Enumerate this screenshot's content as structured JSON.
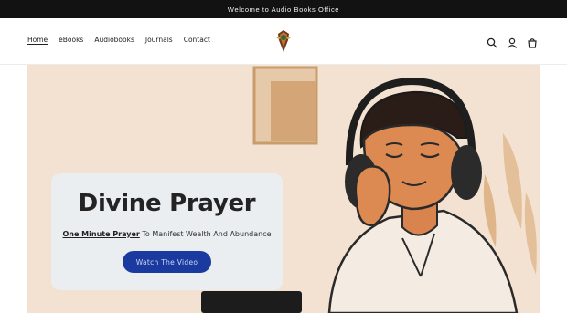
{
  "announcement": {
    "text": "Welcome to Audio Books Office"
  },
  "nav": {
    "items": [
      {
        "label": "Home",
        "active": true
      },
      {
        "label": "eBooks"
      },
      {
        "label": "Audiobooks"
      },
      {
        "label": "Journals"
      },
      {
        "label": "Contact"
      }
    ]
  },
  "header_icons": [
    "search-icon",
    "account-icon",
    "cart-icon"
  ],
  "hero": {
    "title": "Divine Prayer",
    "subtitle_link": "One Minute Prayer",
    "subtitle_rest": " To Manifest Wealth And Abundance",
    "button_label": "Watch The Video"
  },
  "colors": {
    "announce_bg": "#121212",
    "hero_bg": "#f3e2d1",
    "button_bg": "#1a3aa0",
    "card_bg": "#e9eef1"
  }
}
